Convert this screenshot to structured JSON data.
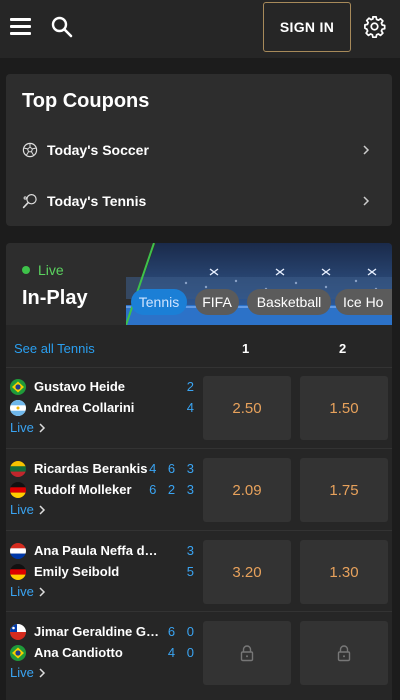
{
  "header": {
    "signin_label": "SIGN IN"
  },
  "coupons": {
    "title": "Top Coupons",
    "items": [
      {
        "label": "Today's Soccer",
        "icon": "soccer-ball-icon"
      },
      {
        "label": "Today's Tennis",
        "icon": "tennis-racket-icon"
      }
    ]
  },
  "inplay": {
    "live_label": "Live",
    "title": "In-Play",
    "tabs": [
      {
        "label": "Tennis",
        "active": true
      },
      {
        "label": "FIFA",
        "active": false
      },
      {
        "label": "Basketball",
        "active": false
      },
      {
        "label": "Ice Ho",
        "active": false
      }
    ],
    "see_all": "See all Tennis",
    "col1": "1",
    "col2": "2",
    "live_link": "Live",
    "matches": [
      {
        "p1": {
          "name": "Gustavo Heide",
          "score": "2",
          "flag": "brazil"
        },
        "p2": {
          "name": "Andrea Collarini",
          "score": "4",
          "flag": "argentina"
        },
        "odd1": "2.50",
        "odd2": "1.50",
        "locked": false
      },
      {
        "p1": {
          "name": "Ricardas Berankis",
          "score": "4 6 3",
          "flag": "lithuania"
        },
        "p2": {
          "name": "Rudolf Molleker",
          "score": "6 2 3",
          "flag": "germany"
        },
        "odd1": "2.09",
        "odd2": "1.75",
        "locked": false
      },
      {
        "p1": {
          "name": "Ana Paula Neffa de Los…",
          "score": "3",
          "flag": "paraguay"
        },
        "p2": {
          "name": "Emily Seibold",
          "score": "5",
          "flag": "germany"
        },
        "odd1": "3.20",
        "odd2": "1.30",
        "locked": false
      },
      {
        "p1": {
          "name": "Jimar Geraldine Geral…",
          "score": "6 0",
          "flag": "chile"
        },
        "p2": {
          "name": "Ana Candiotto",
          "score": "4 0",
          "flag": "brazil"
        },
        "odd1": "",
        "odd2": "",
        "locked": true
      }
    ]
  },
  "colors": {
    "accent_blue": "#1b7fd6",
    "link_blue": "#3aa4f2",
    "odds_orange": "#e8a25c",
    "live_green": "#3ec24a",
    "signin_border": "#a78a5a"
  }
}
